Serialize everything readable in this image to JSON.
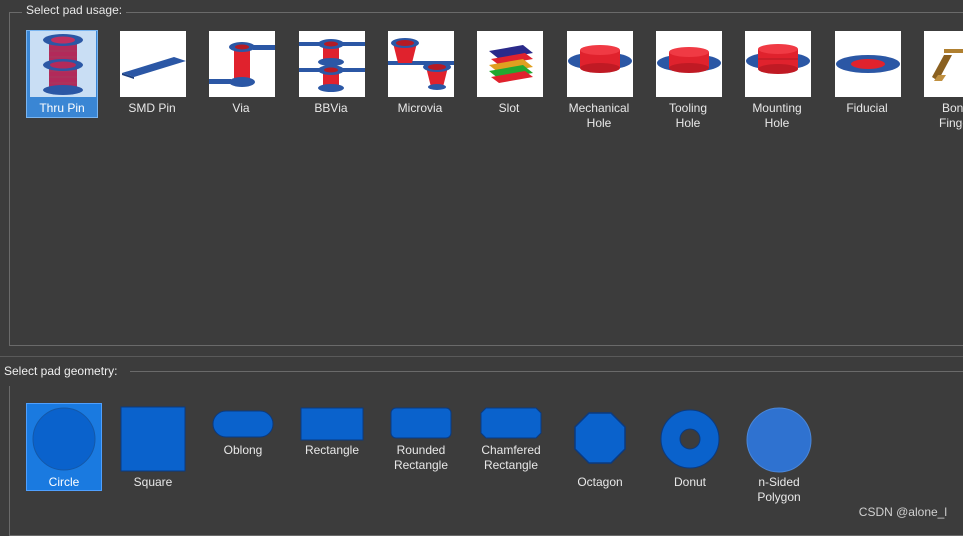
{
  "pad_types_group": {
    "legend": "Select pad usage:",
    "items": [
      {
        "label": "Thru Pin",
        "selected": true
      },
      {
        "label": "SMD Pin"
      },
      {
        "label": "Via"
      },
      {
        "label": "BBVia"
      },
      {
        "label": "Microvia"
      },
      {
        "label": "Slot"
      },
      {
        "label": "Mechanical\nHole"
      },
      {
        "label": "Tooling\nHole"
      },
      {
        "label": "Mounting\nHole"
      },
      {
        "label": "Fiducial"
      },
      {
        "label": "Bond\nFinger"
      }
    ]
  },
  "geometry_group": {
    "legend": "Select pad geometry:",
    "items": [
      {
        "label": "Circle",
        "selected": true
      },
      {
        "label": "Square"
      },
      {
        "label": "Oblong"
      },
      {
        "label": "Rectangle"
      },
      {
        "label": "Rounded\nRectangle"
      },
      {
        "label": "Chamfered\nRectangle"
      },
      {
        "label": "Octagon"
      },
      {
        "label": "Donut"
      },
      {
        "label": "n-Sided\nPolygon"
      }
    ]
  },
  "watermark": "CSDN @alone_l",
  "colors": {
    "background": "#3c3c3c",
    "selection": "#1a7ae0",
    "shape_fill": "#0a62cc",
    "copper_red": "#e0222d",
    "pad_blue": "#2b57a5"
  }
}
